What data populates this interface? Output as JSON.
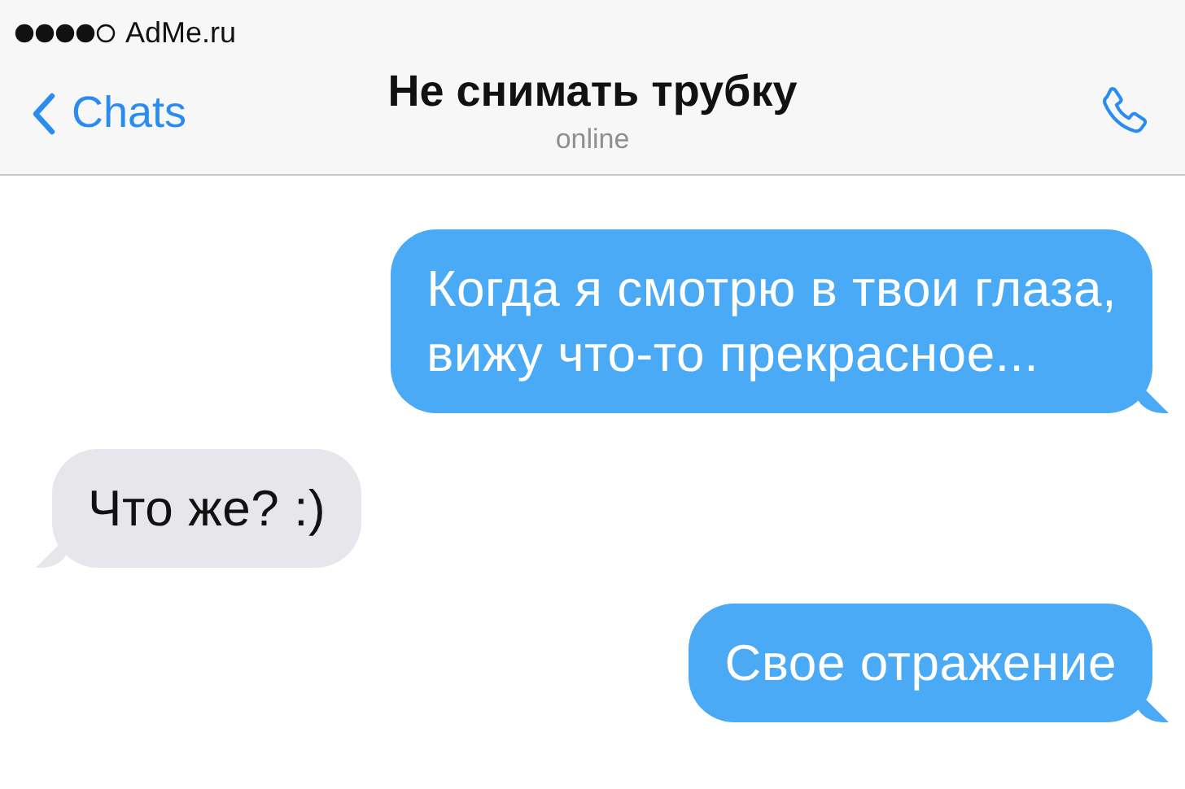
{
  "status_bar": {
    "carrier": "AdMe.ru"
  },
  "header": {
    "back": "Chats",
    "title": "Не снимать трубку",
    "subtitle": "online"
  },
  "messages": [
    {
      "kind": "outgoing",
      "text": "Когда я смотрю в твои глаза,\nвижу что-то прекрасное..."
    },
    {
      "kind": "incoming",
      "text": "Что же? :)"
    },
    {
      "kind": "outgoing",
      "text": "Свое отражение"
    }
  ]
}
